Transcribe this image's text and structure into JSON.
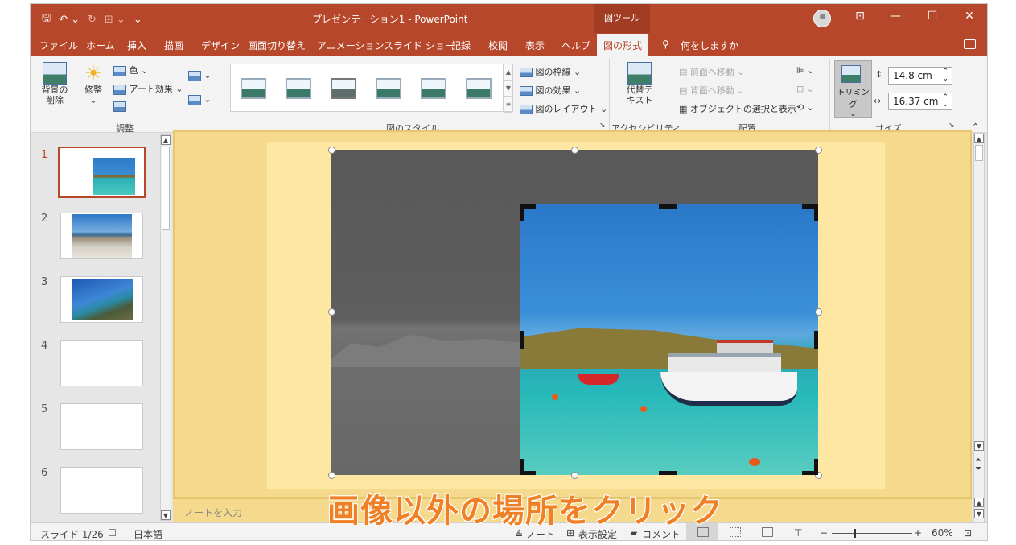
{
  "titlebar": {
    "title": "プレゼンテーション1  -  PowerPoint",
    "tools_tab": "図ツール",
    "qat": {
      "save": "🖫",
      "undo": "↶ ⌄",
      "redo": "↻",
      "start": "⊞ ⌄",
      "customize": "⌄"
    }
  },
  "window": {
    "ribbon_display": "⊡",
    "minimize": "—",
    "maximize": "☐",
    "close": "✕"
  },
  "menu": {
    "tabs": [
      "ファイル",
      "ホーム",
      "挿入",
      "描画",
      "デザイン",
      "画面切り替え",
      "アニメーション",
      "スライド ショー",
      "記録",
      "校閲",
      "表示",
      "ヘルプ",
      "図の形式"
    ],
    "search": "何をしますか",
    "active": "図の形式"
  },
  "ribbon": {
    "adjust": {
      "remove_bg": "背景の\n削除",
      "corrections": "修整",
      "color": "色 ⌄",
      "artistic": "アート効果 ⌄",
      "group": "調整"
    },
    "styles": {
      "border": "図の枠線 ⌄",
      "effects": "図の効果 ⌄",
      "layout": "図のレイアウト ⌄",
      "group": "図のスタイル"
    },
    "accessibility": {
      "alt_text": "代替テ\nキスト",
      "group": "アクセシビリティ"
    },
    "arrange": {
      "bring_forward": "前面へ移動  ⌄",
      "send_backward": "背面へ移動  ⌄",
      "selection_pane": "オブジェクトの選択と表示",
      "group": "配置"
    },
    "size": {
      "crop": "トリミング",
      "height": "14.8 cm",
      "width": "16.37 cm",
      "group": "サイズ"
    }
  },
  "slides": [
    {
      "num": "1",
      "active": true
    },
    {
      "num": "2"
    },
    {
      "num": "3"
    },
    {
      "num": "4"
    },
    {
      "num": "5"
    },
    {
      "num": "6"
    }
  ],
  "notes_placeholder": "ノートを入力",
  "annotation": "画像以外の場所をクリック",
  "statusbar": {
    "slide": "スライド 1/26",
    "language": "日本語",
    "notes": "≜ ノート",
    "display_settings": "表示設定",
    "comments": "コメント",
    "zoom": "60%"
  }
}
